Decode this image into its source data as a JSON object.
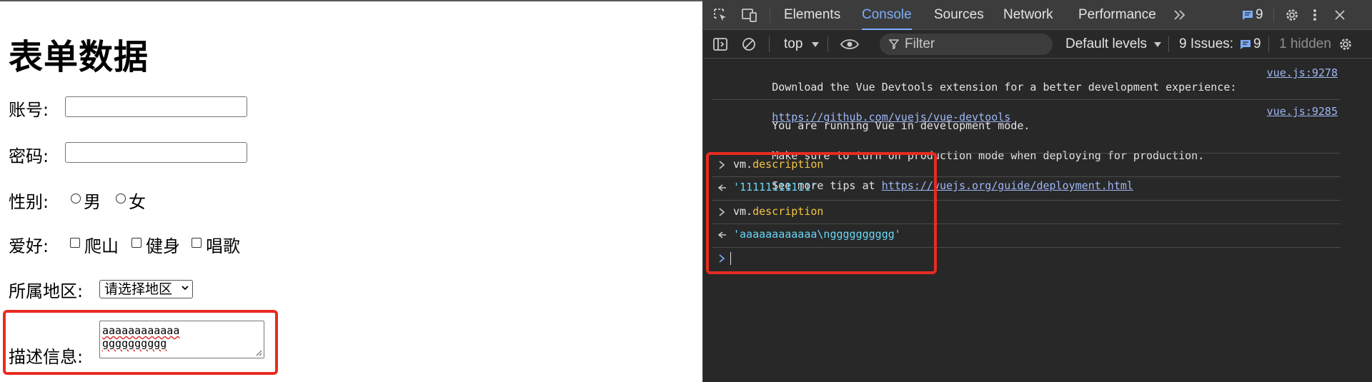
{
  "page": {
    "heading": "表单数据",
    "account_label": "账号:",
    "password_label": "密码:",
    "gender_label": "性别:",
    "gender_options": [
      "男",
      "女"
    ],
    "hobby_label": "爱好:",
    "hobby_options": [
      "爬山",
      "健身",
      "唱歌"
    ],
    "region_label": "所属地区:",
    "region_select_value": "请选择地区",
    "description_label": "描述信息:",
    "description_lines": [
      "aaaaaaaaaaaa",
      "gggggggggg"
    ]
  },
  "devtools": {
    "tabs": [
      "Elements",
      "Console",
      "Sources",
      "Network",
      "Performance"
    ],
    "active_tab": "Console",
    "overflow_icon": "chevrons-right-icon",
    "messages_badge": "9",
    "toolbar": {
      "context": "top",
      "filter_placeholder": "Filter",
      "levels": "Default levels",
      "issues_label": "9 Issues:",
      "issues_count": "9",
      "hidden": "1 hidden"
    },
    "console": {
      "msg1_text": "Download the Vue Devtools extension for a better development experience:",
      "msg1_link": "https://github.com/vuejs/vue-devtools",
      "msg1_source": "vue.js:9278",
      "msg2_line1": "You are running Vue in development mode.",
      "msg2_line2": "Make sure to turn on production mode when deploying for production.",
      "msg2_line3_prefix": "See more tips at ",
      "msg2_link": "https://vuejs.org/guide/deployment.html",
      "msg2_source": "vue.js:9285",
      "input1_obj": "vm.",
      "input1_prop": "description",
      "output1": "'11111111111'",
      "input2_obj": "vm.",
      "input2_prop": "description",
      "output2": "'aaaaaaaaaaaa\\ngggggggggg'"
    },
    "colors": {
      "accent": "#7cacf8",
      "property": "#f5c542",
      "string": "#6ad5f5",
      "highlight_box": "#e82b22"
    }
  }
}
